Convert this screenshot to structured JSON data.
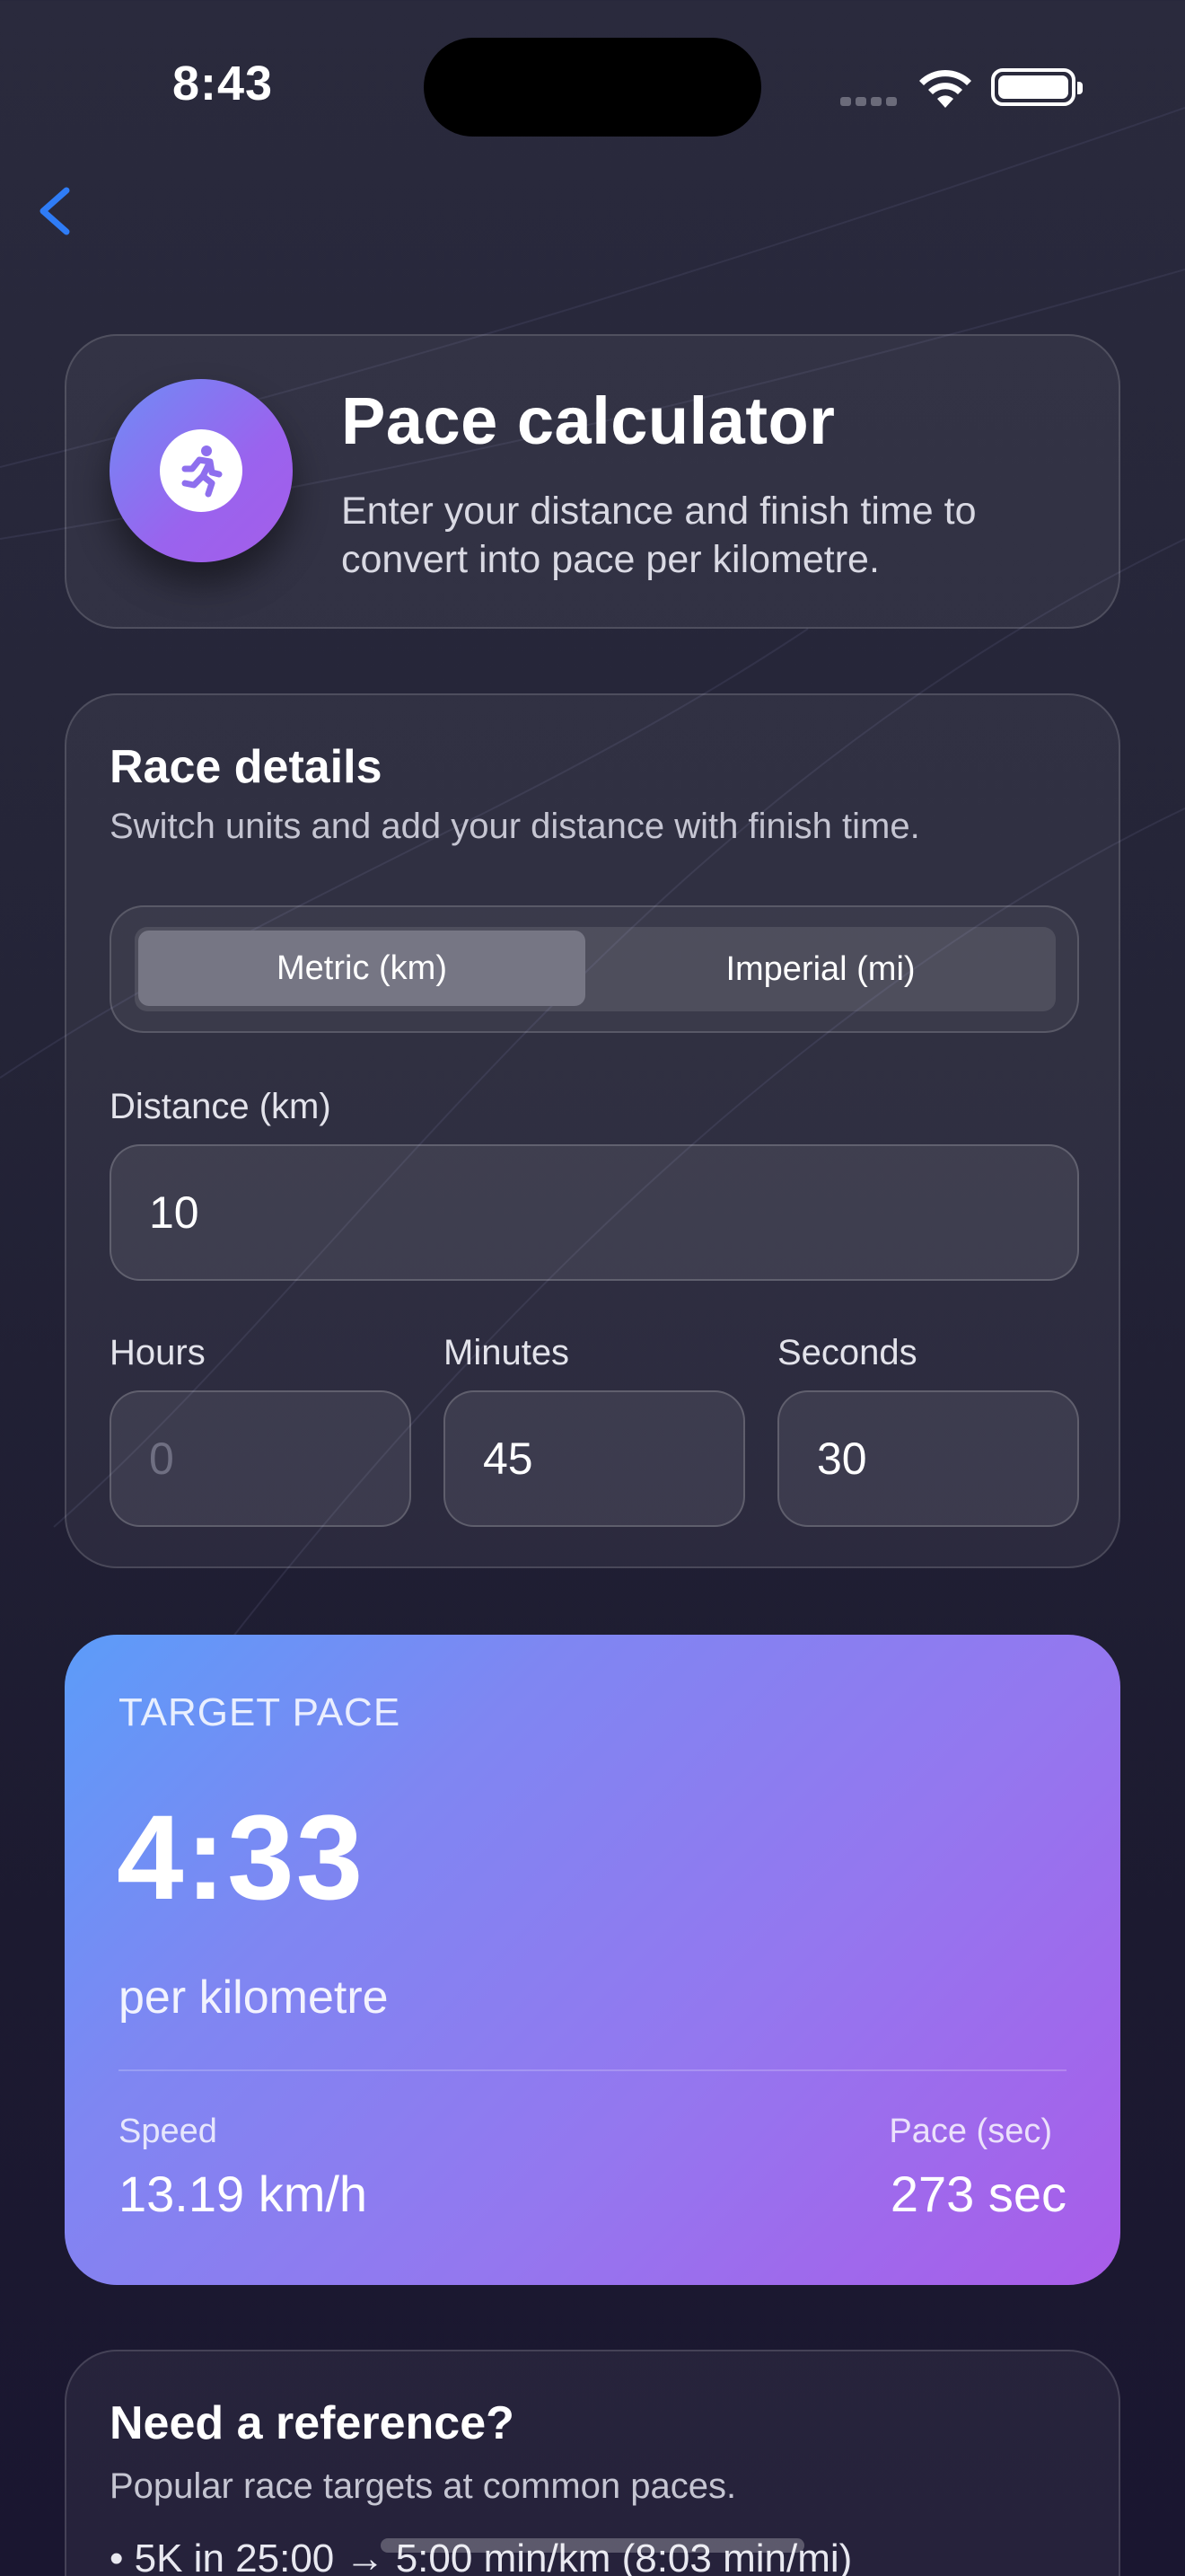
{
  "status_bar": {
    "time": "8:43",
    "icons": [
      "cellular-signal-icon",
      "wifi-icon",
      "battery-icon"
    ]
  },
  "nav": {
    "back_icon": "chevron-left-icon"
  },
  "header": {
    "icon": "running-figure-icon",
    "title": "Pace calculator",
    "subtitle": "Enter your distance and finish time to convert into pace per kilometre."
  },
  "race_details": {
    "title": "Race details",
    "subtitle": "Switch units and add your distance with finish time.",
    "units": {
      "options": [
        "Metric (km)",
        "Imperial (mi)"
      ],
      "selected": "Metric (km)"
    },
    "distance": {
      "label": "Distance (km)",
      "value": "10"
    },
    "hours": {
      "label": "Hours",
      "value": "",
      "placeholder": "0"
    },
    "minutes": {
      "label": "Minutes",
      "value": "45"
    },
    "seconds": {
      "label": "Seconds",
      "value": "30"
    }
  },
  "result": {
    "eyebrow": "TARGET PACE",
    "pace": "4:33",
    "unit": "per kilometre",
    "speed_label": "Speed",
    "speed_value": "13.19 km/h",
    "pace_sec_label": "Pace (sec)",
    "pace_sec_value": "273 sec"
  },
  "reference": {
    "title": "Need a reference?",
    "subtitle": "Popular race targets at common paces.",
    "items": [
      "5K in 25:00 → 5:00 min/km (8:03 min/mi)"
    ]
  },
  "colors": {
    "background": "#242437",
    "accent_blue": "#5c9cf9",
    "accent_purple": "#a95ce9",
    "back_button": "#2f7cf6"
  }
}
